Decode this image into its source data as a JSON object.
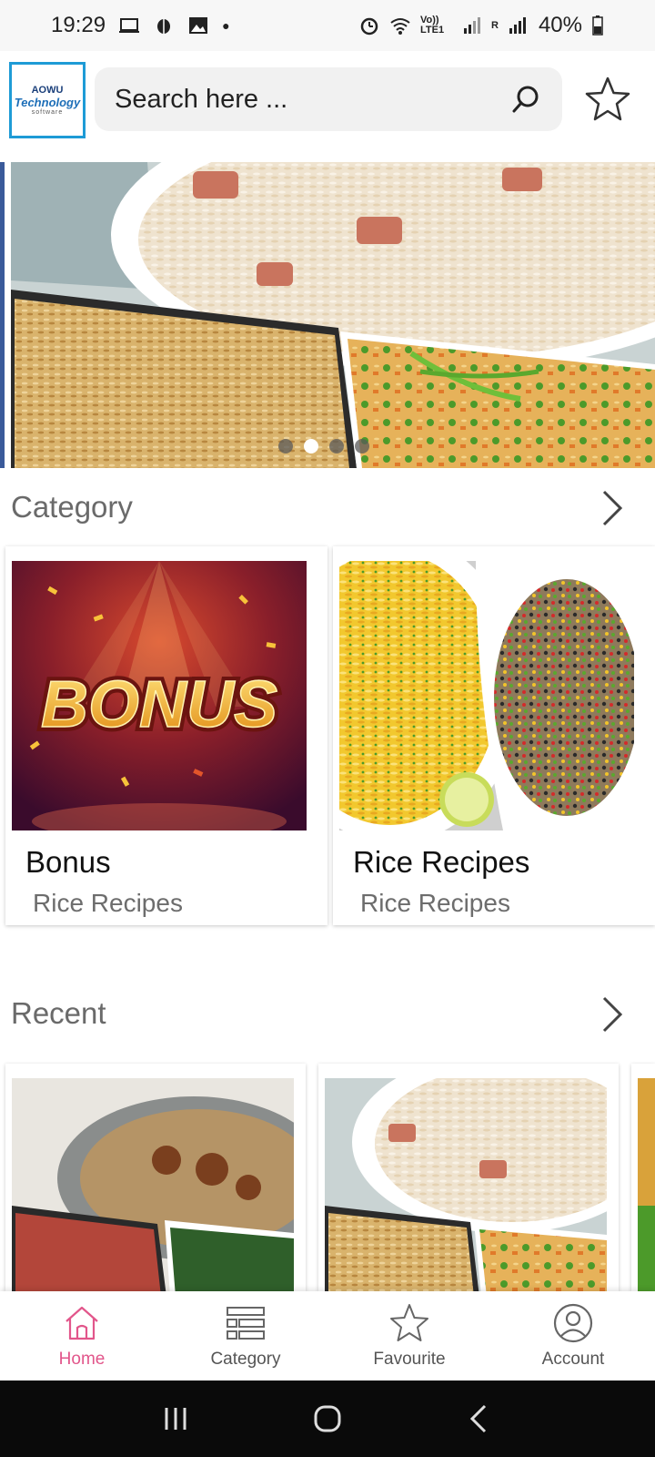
{
  "status_bar": {
    "time": "19:29",
    "battery": "40%",
    "volte": "Vo)) LTE1",
    "roaming": "R"
  },
  "header": {
    "logo": {
      "line1": "AOWU",
      "line2": "Technology",
      "line3": "software"
    },
    "search_placeholder": "Search here ..."
  },
  "banner": {
    "dots": 4,
    "active_dot": 2
  },
  "category_section": {
    "title": "Category",
    "items": [
      {
        "title": "Bonus",
        "subtitle": "Rice Recipes",
        "image_text": "BONUS"
      },
      {
        "title": "Rice Recipes",
        "subtitle": "Rice Recipes"
      }
    ]
  },
  "recent_section": {
    "title": "Recent"
  },
  "bottom_nav": {
    "items": [
      {
        "label": "Home",
        "icon": "home-icon",
        "active": true
      },
      {
        "label": "Category",
        "icon": "list-icon",
        "active": false
      },
      {
        "label": "Favourite",
        "icon": "star-icon",
        "active": false
      },
      {
        "label": "Account",
        "icon": "account-icon",
        "active": false
      }
    ]
  },
  "colors": {
    "accent": "#e2568b",
    "logo_border": "#1e9bd6"
  }
}
